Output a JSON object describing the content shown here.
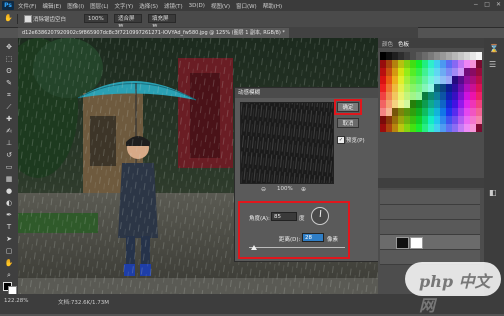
{
  "app": {
    "logo": "Ps"
  },
  "menu": [
    "文件(F)",
    "编辑(E)",
    "图像(I)",
    "图层(L)",
    "文字(Y)",
    "选择(S)",
    "滤镜(T)",
    "3D(D)",
    "视图(V)",
    "窗口(W)",
    "帮助(H)"
  ],
  "window_controls": [
    "−",
    "□",
    "✕"
  ],
  "options": {
    "checkbox_label": "消除锯齿空白",
    "zoom_value": "100%",
    "fit_label": "适合屏幕",
    "fill_label": "填充屏幕"
  },
  "document_tab": "d12e6386207920902c9f865907dc8c3f7210997261271-lOVYAd_fw580.jpg @ 125% (图层 1 副本, RGB/8) *",
  "dialog": {
    "title": "动感模糊",
    "ok": "确定",
    "cancel": "取消",
    "preview_label": "预览(P)",
    "zoom": "100%",
    "angle_label": "角度(A):",
    "angle_value": "85",
    "angle_unit": "度",
    "distance_label": "距离(D):",
    "distance_value": "28",
    "distance_unit": "像素"
  },
  "panels": {
    "tab1": "颜色",
    "tab2": "色板"
  },
  "status": {
    "zoom": "122.28%",
    "doc": "文档:732.6K/1.73M"
  },
  "watermark": "php 中文网",
  "colors": {
    "highlight": "#e0161c",
    "accent_blue": "#2f7ec6"
  }
}
